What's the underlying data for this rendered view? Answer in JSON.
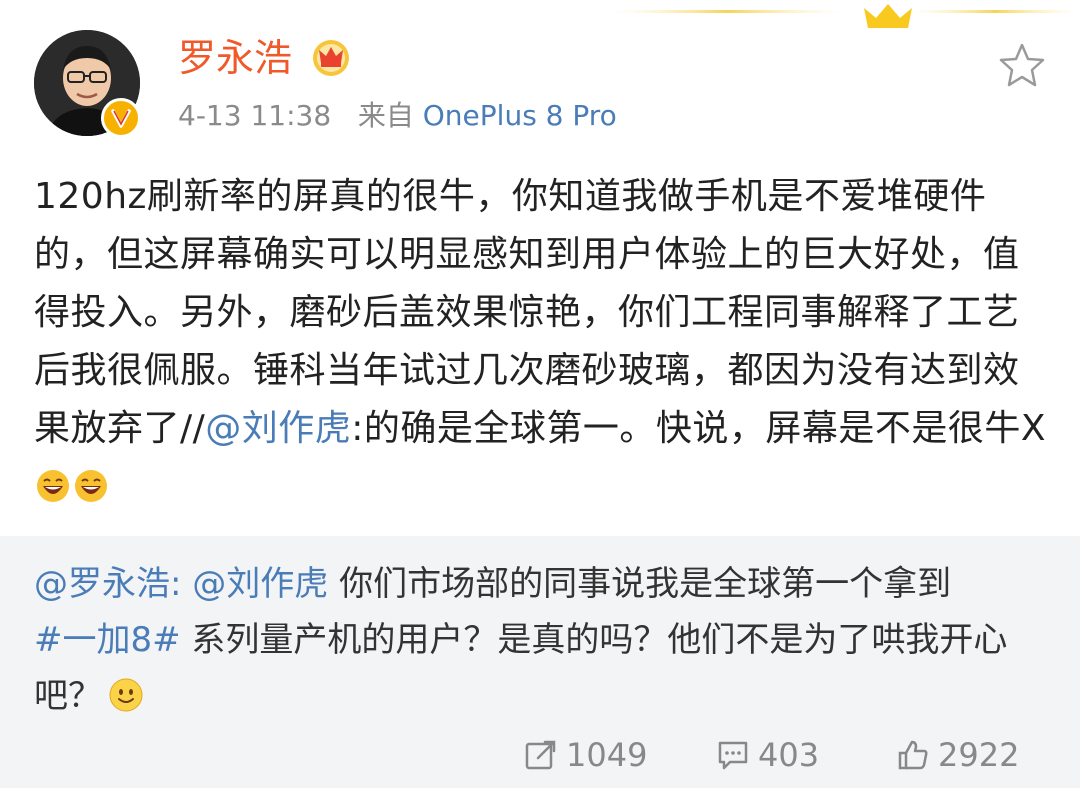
{
  "header": {
    "username": "罗永浩",
    "time": "4-13 11:38",
    "source_prefix": "来自",
    "source_device": "OnePlus 8 Pro"
  },
  "post": {
    "text_main": "120hz刷新率的屏真的很牛，你知道我做手机是不爱堆硬件的，但这屏幕确实可以明显感知到用户体验上的巨大好处，值得投入。另外，磨砂后盖效果惊艳，你们工程同事解释了工艺后我很佩服。锤科当年试过几次磨砂玻璃，都因为没有达到效果放弃了//",
    "mention": "@刘作虎",
    "text_after_mention": ":的确是全球第一。快说，屏幕是不是很牛X"
  },
  "repost": {
    "author": "@罗永浩:",
    "mention": "@刘作虎",
    "text_1": " 你们市场部的同事说我是全球第一个拿到",
    "hashtag": "#一加8#",
    "text_2": " 系列量产机的用户？是真的吗？他们不是为了哄我开心吧？"
  },
  "actions": {
    "repost_count": "1049",
    "comment_count": "403",
    "like_count": "2922"
  },
  "colors": {
    "username": "#f05a2a",
    "link": "#4a7cb8",
    "repost_bg": "#f3f4f6",
    "verified": "#f7b100"
  },
  "icons": [
    "crown-decoration",
    "verified-v-icon",
    "vip-crown-icon",
    "star-icon",
    "laugh-emoji",
    "smile-emoji",
    "repost-icon",
    "comment-icon",
    "like-icon"
  ]
}
